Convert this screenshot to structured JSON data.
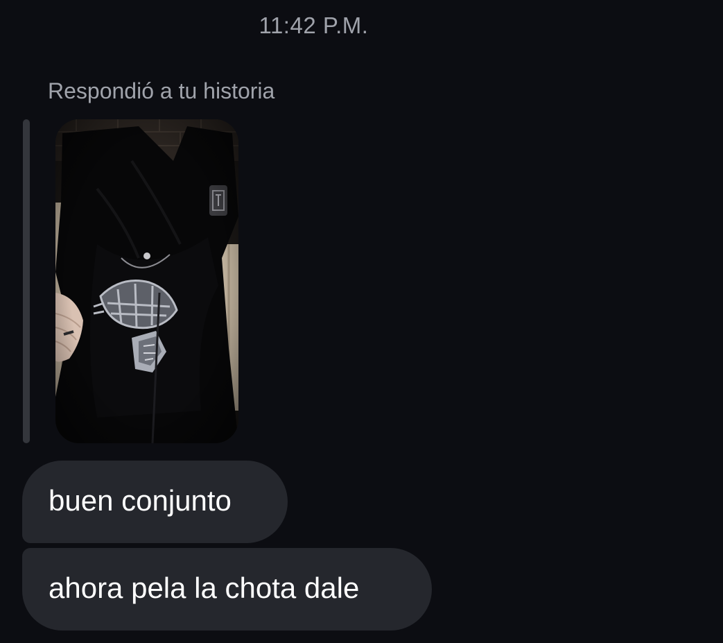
{
  "timestamp": "11:42 P.M.",
  "reply": {
    "label": "Respondió a tu historia"
  },
  "messages": [
    {
      "text": "buen conjunto"
    },
    {
      "text": "ahora pela la chota dale"
    }
  ],
  "colors": {
    "background": "#0c0d12",
    "bubble": "#25272d",
    "muted_text": "#a0a3ab",
    "reply_bar": "#34363c"
  }
}
